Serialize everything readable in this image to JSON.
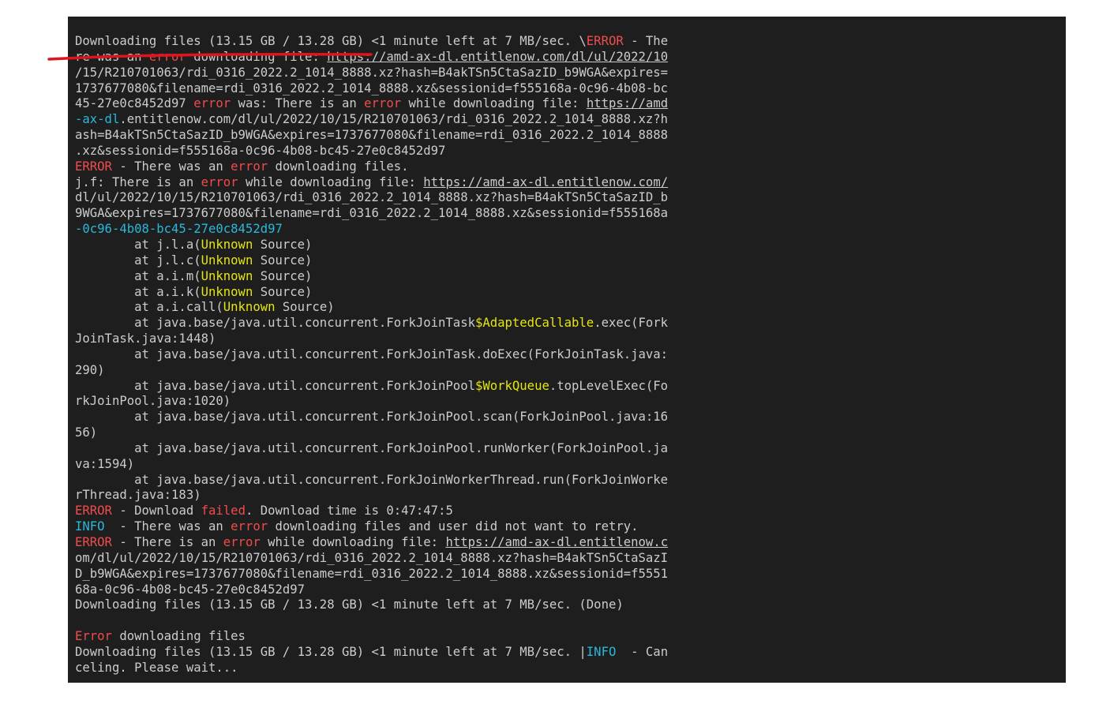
{
  "terminal": {
    "lines": [
      [
        {
          "t": "Downloading files (13.15 GB / 13.28 GB) <1 minute left at 7 MB/sec. \\"
        },
        {
          "t": "ERROR",
          "c": "red"
        },
        {
          "t": " - The"
        }
      ],
      [
        {
          "t": "re was an "
        },
        {
          "t": "error",
          "c": "red"
        },
        {
          "t": " downloading file: "
        },
        {
          "t": "https://amd-ax-dl.entitlenow.com/dl/ul/2022/10",
          "c": "link"
        }
      ],
      [
        {
          "t": "/15/R210701063/rdi_0316_2022.2_1014_8888.xz?hash=B4akTSn5CtaSazID_b9WGA&expires="
        }
      ],
      [
        {
          "t": "1737677080&filename=rdi_0316_2022.2_1014_8888.xz&sessionid=f555168a-0c96-4b08-bc"
        }
      ],
      [
        {
          "t": "45-27e0c8452d97 "
        },
        {
          "t": "error",
          "c": "red"
        },
        {
          "t": " was: There is an "
        },
        {
          "t": "error",
          "c": "red"
        },
        {
          "t": " while downloading file: "
        },
        {
          "t": "https://amd",
          "c": "link"
        }
      ],
      [
        {
          "t": "-ax-dl",
          "c": "cyan"
        },
        {
          "t": ".entitlenow.com/dl/ul/2022/10/15/R210701063/rdi_0316_2022.2_1014_8888.xz?h"
        }
      ],
      [
        {
          "t": "ash=B4akTSn5CtaSazID_b9WGA&expires=1737677080&filename=rdi_0316_2022.2_1014_8888"
        }
      ],
      [
        {
          "t": ".xz&sessionid=f555168a-0c96-4b08-bc45-27e0c8452d97"
        }
      ],
      [
        {
          "t": "ERROR",
          "c": "red"
        },
        {
          "t": " - There was an "
        },
        {
          "t": "error",
          "c": "red"
        },
        {
          "t": " downloading files."
        }
      ],
      [
        {
          "t": "j.f: There is an "
        },
        {
          "t": "error",
          "c": "red"
        },
        {
          "t": " while downloading file: "
        },
        {
          "t": "https://amd-ax-dl.entitlenow.com/",
          "c": "link"
        }
      ],
      [
        {
          "t": "dl/ul/2022/10/15/R210701063/rdi_0316_2022.2_1014_8888.xz?hash=B4akTSn5CtaSazID_b"
        }
      ],
      [
        {
          "t": "9WGA&expires=1737677080&filename=rdi_0316_2022.2_1014_8888.xz&sessionid=f555168a"
        }
      ],
      [
        {
          "t": "-0c96-4b08-bc45-27e0c8452d97",
          "c": "cyan"
        }
      ],
      [
        {
          "t": "        at j.l.a("
        },
        {
          "t": "Unknown",
          "c": "yellow"
        },
        {
          "t": " Source)"
        }
      ],
      [
        {
          "t": "        at j.l.c("
        },
        {
          "t": "Unknown",
          "c": "yellow"
        },
        {
          "t": " Source)"
        }
      ],
      [
        {
          "t": "        at a.i.m("
        },
        {
          "t": "Unknown",
          "c": "yellow"
        },
        {
          "t": " Source)"
        }
      ],
      [
        {
          "t": "        at a.i.k("
        },
        {
          "t": "Unknown",
          "c": "yellow"
        },
        {
          "t": " Source)"
        }
      ],
      [
        {
          "t": "        at a.i.call("
        },
        {
          "t": "Unknown",
          "c": "yellow"
        },
        {
          "t": " Source)"
        }
      ],
      [
        {
          "t": "        at java.base/java.util.concurrent.ForkJoinTask"
        },
        {
          "t": "$AdaptedCallable",
          "c": "yellow"
        },
        {
          "t": ".exec(Fork"
        }
      ],
      [
        {
          "t": "JoinTask.java:1448)"
        }
      ],
      [
        {
          "t": "        at java.base/java.util.concurrent.ForkJoinTask.doExec(ForkJoinTask.java:"
        }
      ],
      [
        {
          "t": "290)"
        }
      ],
      [
        {
          "t": "        at java.base/java.util.concurrent.ForkJoinPool"
        },
        {
          "t": "$WorkQueue",
          "c": "yellow"
        },
        {
          "t": ".topLevelExec(Fo"
        }
      ],
      [
        {
          "t": "rkJoinPool.java:1020)"
        }
      ],
      [
        {
          "t": "        at java.base/java.util.concurrent.ForkJoinPool.scan(ForkJoinPool.java:16"
        }
      ],
      [
        {
          "t": "56)"
        }
      ],
      [
        {
          "t": "        at java.base/java.util.concurrent.ForkJoinPool.runWorker(ForkJoinPool.ja"
        }
      ],
      [
        {
          "t": "va:1594)"
        }
      ],
      [
        {
          "t": "        at java.base/java.util.concurrent.ForkJoinWorkerThread.run(ForkJoinWorke"
        }
      ],
      [
        {
          "t": "rThread.java:183)"
        }
      ],
      [
        {
          "t": "ERROR",
          "c": "red"
        },
        {
          "t": " - Download "
        },
        {
          "t": "failed",
          "c": "red"
        },
        {
          "t": ". Download time is 0:47:47:5"
        }
      ],
      [
        {
          "t": "INFO ",
          "c": "cyan"
        },
        {
          "t": " - There was an "
        },
        {
          "t": "error",
          "c": "red"
        },
        {
          "t": " downloading files and user did not want to retry."
        }
      ],
      [
        {
          "t": "ERROR",
          "c": "red"
        },
        {
          "t": " - There is an "
        },
        {
          "t": "error",
          "c": "red"
        },
        {
          "t": " while downloading file: "
        },
        {
          "t": "https://amd-ax-dl.entitlenow.c",
          "c": "link"
        }
      ],
      [
        {
          "t": "om/dl/ul/2022/10/15/R210701063/rdi_0316_2022.2_1014_8888.xz?hash=B4akTSn5CtaSazI"
        }
      ],
      [
        {
          "t": "D_b9WGA&expires=1737677080&filename=rdi_0316_2022.2_1014_8888.xz&sessionid=f5551"
        }
      ],
      [
        {
          "t": "68a-0c96-4b08-bc45-27e0c8452d97"
        }
      ],
      [
        {
          "t": "Downloading files (13.15 GB / 13.28 GB) <1 minute left at 7 MB/sec. (Done)"
        }
      ],
      [
        {
          "t": ""
        }
      ],
      [
        {
          "t": "Error",
          "c": "red"
        },
        {
          "t": " downloading files"
        }
      ],
      [
        {
          "t": "Downloading files (13.15 GB / 13.28 GB) <1 minute left at 7 MB/sec. |"
        },
        {
          "t": "INFO ",
          "c": "cyan"
        },
        {
          "t": " - Can"
        }
      ],
      [
        {
          "t": "celing. Please wait..."
        }
      ]
    ]
  },
  "colors": {
    "background": "#1e1e1e",
    "text": "#cccccc",
    "error_red": "#f14c4c",
    "keyword_yellow": "#e5e510",
    "info_cyan": "#29b8db",
    "annotation_stroke": "#e0141e"
  }
}
